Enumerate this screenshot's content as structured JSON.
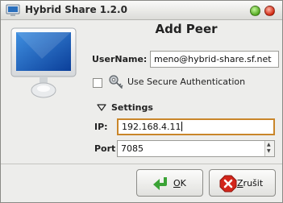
{
  "window": {
    "title": "Hybrid Share 1.2.0"
  },
  "dialog": {
    "heading": "Add Peer"
  },
  "form": {
    "username_label": "UserName:",
    "username_value": "meno@hybrid-share.sf.net",
    "secure_auth_label": "Use Secure Authentication",
    "secure_auth_checked": false,
    "settings_label": "Settings",
    "ip_label": "IP:",
    "ip_value": "192.168.4.11",
    "port_label": "Port",
    "port_value": "7085"
  },
  "buttons": {
    "ok_mnemonic": "O",
    "ok_rest": "K",
    "cancel_mnemonic": "Z",
    "cancel_rest": "rušit"
  },
  "icons": {
    "app": "app-icon",
    "monitor": "monitor-icon",
    "key": "key-icon",
    "expander": "expander-arrow-icon",
    "ok": "enter-arrow-icon",
    "cancel": "cancel-x-icon"
  },
  "colors": {
    "focus_border": "#c9862a",
    "ok_icon": "#3aa335",
    "cancel_icon": "#d3261b"
  }
}
